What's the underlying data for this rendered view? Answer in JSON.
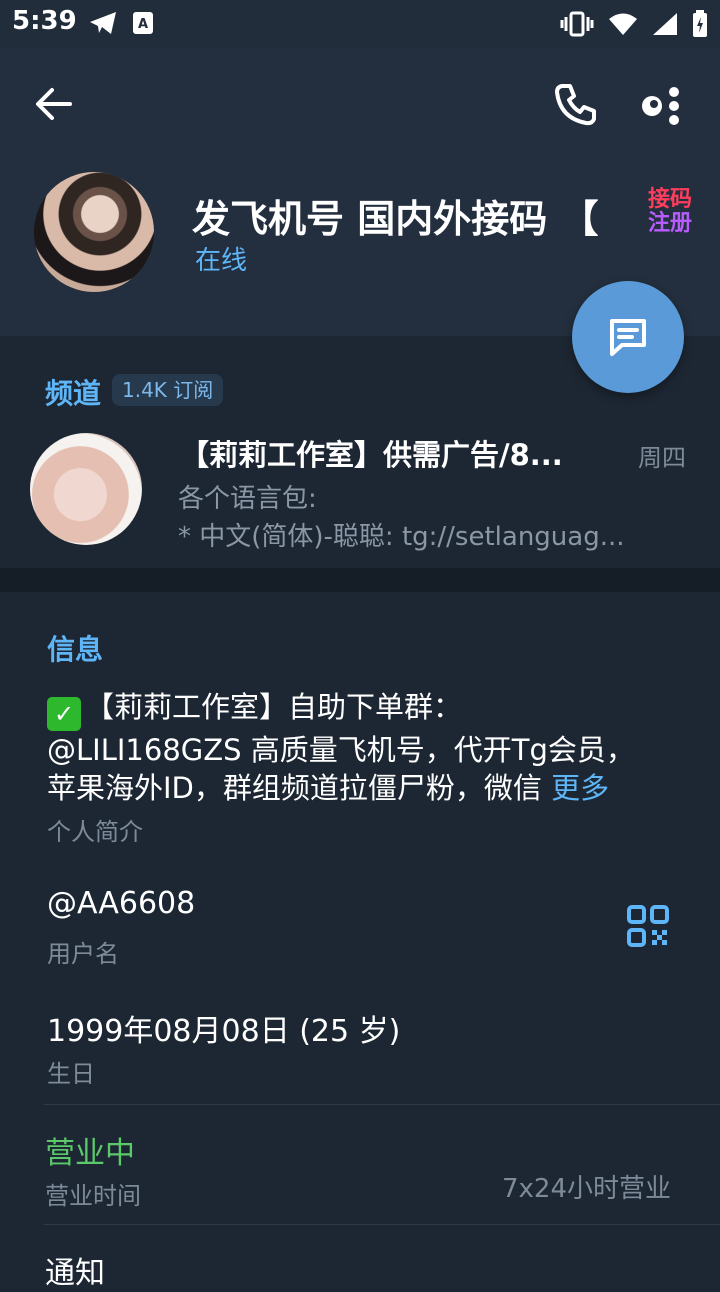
{
  "status_bar": {
    "time": "5:39",
    "left_icons": [
      "telegram-icon",
      "a-badge-icon"
    ],
    "right_icons": [
      "vibrate-icon",
      "wifi-icon",
      "signal-icon",
      "battery-icon"
    ]
  },
  "header": {
    "name": "发飞机号 国内外接码 【",
    "status": "在线",
    "emoji_badge_line1": "接码",
    "emoji_badge_line2": "注册"
  },
  "channel": {
    "section_title": "频道",
    "subscribers": "1.4K 订阅",
    "name": "【莉莉工作室】供需广告/8...",
    "date": "周四",
    "message_line1": "各个语言包:",
    "message_line2": "* 中文(简体)-聪聪: tg://setlanguag..."
  },
  "info": {
    "section_title": "信息",
    "bio_check": "✓",
    "bio_line1": "【莉莉工作室】自助下单群：",
    "bio_line2": "@LILI168GZS 高质量飞机号，代开Tg会员，",
    "bio_line3": "苹果海外ID，群组频道拉僵尸粉，微信",
    "bio_more": "更多",
    "bio_label": "个人简介",
    "username": "@AA6608",
    "username_label": "用户名",
    "birthday": "1999年08月08日 (25 岁)",
    "birthday_label": "生日",
    "business_status": "营业中",
    "business_label": "营业时间",
    "business_value": "7x24小时营业",
    "notifications": "通知"
  },
  "colors": {
    "accent": "#5eb5f7",
    "background": "#1d2733",
    "header_bg": "#232f3e",
    "open_green": "#5bc96a",
    "fab": "#5a9ad8"
  }
}
